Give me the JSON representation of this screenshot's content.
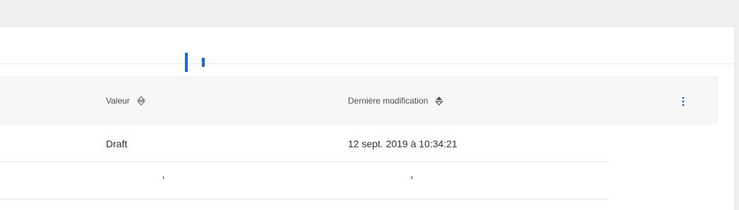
{
  "table": {
    "columns": {
      "valeur": "Valeur",
      "derniere_modification": "Dernière modification"
    },
    "rows": [
      {
        "valeur": "Draft",
        "derniere_modification": "12 sept. 2019 à 10:34:21"
      }
    ]
  },
  "icons": {
    "sort_valeur": "sort-unsorted-icon",
    "sort_modif": "sort-active-icon",
    "menu": "more-vertical-icon"
  },
  "colors": {
    "accent": "#1a6cc4",
    "background": "#eeeff1",
    "header_bg": "#f7f7f7"
  }
}
